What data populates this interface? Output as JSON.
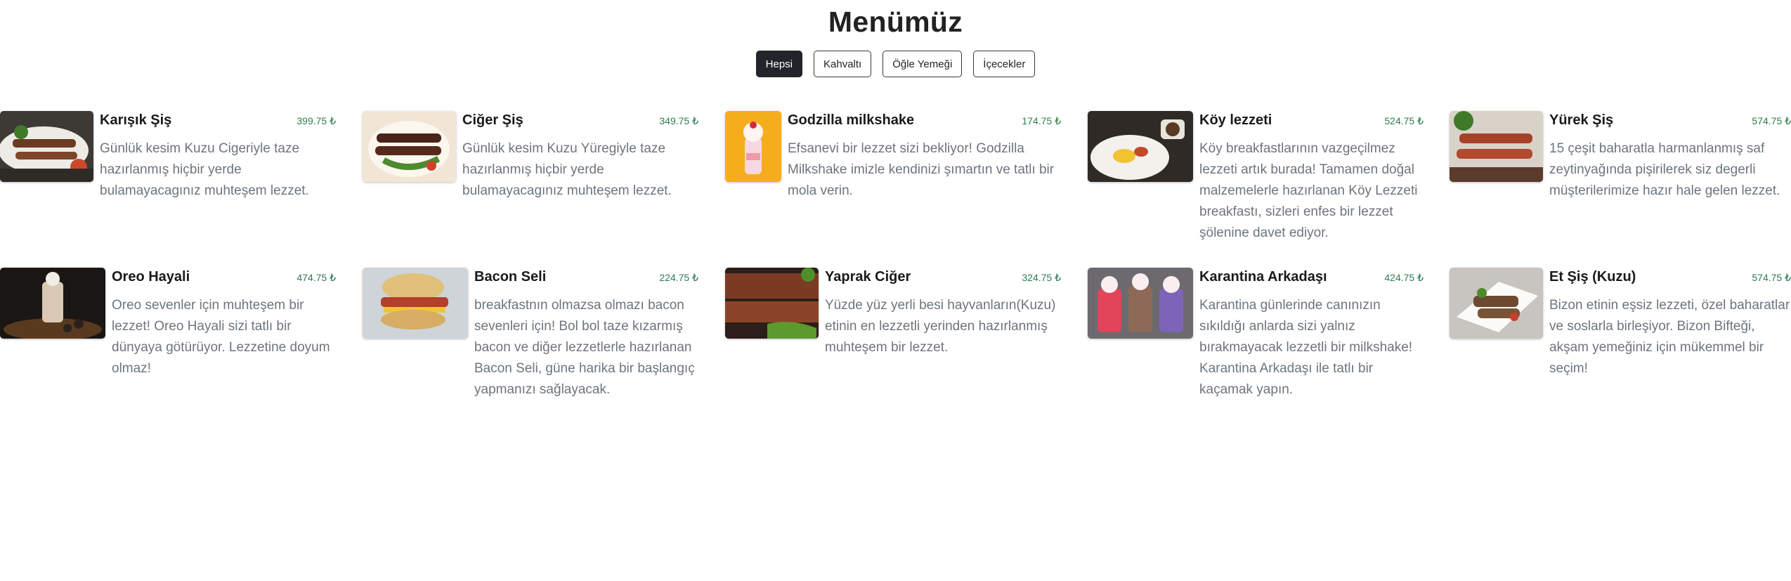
{
  "title": "Menümüz",
  "filters": [
    "Hepsi",
    "Kahvaltı",
    "Öğle Yemeği",
    "İçecekler"
  ],
  "items": [
    {
      "name": "Karışık Şiş",
      "price": "399.75 ₺",
      "desc": "Günlük kesim Kuzu Cigeriyle taze hazırlanmış hiçbir yerde bulamayacagınız muhteşem lezzet.",
      "image": "kebab-plate-image"
    },
    {
      "name": "Ciğer Şiş",
      "price": "349.75 ₺",
      "desc": "Günlük kesim Kuzu Yüregiyle taze hazırlanmış hiçbir yerde bulamayacagınız muhteşem lezzet.",
      "image": "liver-skewers-image"
    },
    {
      "name": "Godzilla milkshake",
      "price": "174.75 ₺",
      "desc": "Efsanevi bir lezzet sizi bekliyor! Godzilla Milkshake imizle kendinizi şımartın ve tatlı bir mola verin.",
      "image": "milkshake-image"
    },
    {
      "name": "Köy lezzeti",
      "price": "524.75 ₺",
      "desc": "Köy breakfastlarının vazgeçilmez lezzeti artık burada! Tamamen doğal malzemelerle hazırlanan Köy Lezzeti breakfastı, sizleri enfes bir lezzet şölenine davet ediyor.",
      "image": "breakfast-image"
    },
    {
      "name": "Yürek Şiş",
      "price": "574.75 ₺",
      "desc": "15 çeşit baharatla harmanlanmış saf zeytinyağında pişirilerek siz degerli müşterilerimize hazır hale gelen lezzet.",
      "image": "heart-skewers-image"
    },
    {
      "name": "Oreo Hayali",
      "price": "474.75 ₺",
      "desc": "Oreo sevenler için muhteşem bir lezzet! Oreo Hayali sizi tatlı bir dünyaya götürüyor. Lezzetine doyum olmaz!",
      "image": "oreo-shake-image"
    },
    {
      "name": "Bacon Seli",
      "price": "224.75 ₺",
      "desc": "breakfastnın olmazsa olmazı bacon sevenleri için! Bol bol taze kızarmış bacon ve diğer lezzetlerle hazırlanan Bacon Seli, güne harika bir başlangıç yapmanızı sağlayacak.",
      "image": "bacon-sandwich-image"
    },
    {
      "name": "Yaprak Ciğer",
      "price": "324.75 ₺",
      "desc": "Yüzde yüz yerli besi hayvanların(Kuzu) etinin en lezzetli yerinden hazırlanmış muhteşem bir lezzet.",
      "image": "grilled-liver-image"
    },
    {
      "name": "Karantina Arkadaşı",
      "price": "424.75 ₺",
      "desc": "Karantina günlerinde canınızın sıkıldığı anlarda sizi yalnız bırakmayacak lezzetli bir milkshake! Karantina Arkadaşı ile tatlı bir kaçamak yapın.",
      "image": "three-milkshakes-image"
    },
    {
      "name": "Et Şiş (Kuzu)",
      "price": "574.75 ₺",
      "desc": "Bizon etinin eşsiz lezzeti, özel baharatlar ve soslarla birleşiyor. Bizon Bifteği, akşam yemeğiniz için mükemmel bir seçim!",
      "image": "meat-skewers-image"
    }
  ]
}
